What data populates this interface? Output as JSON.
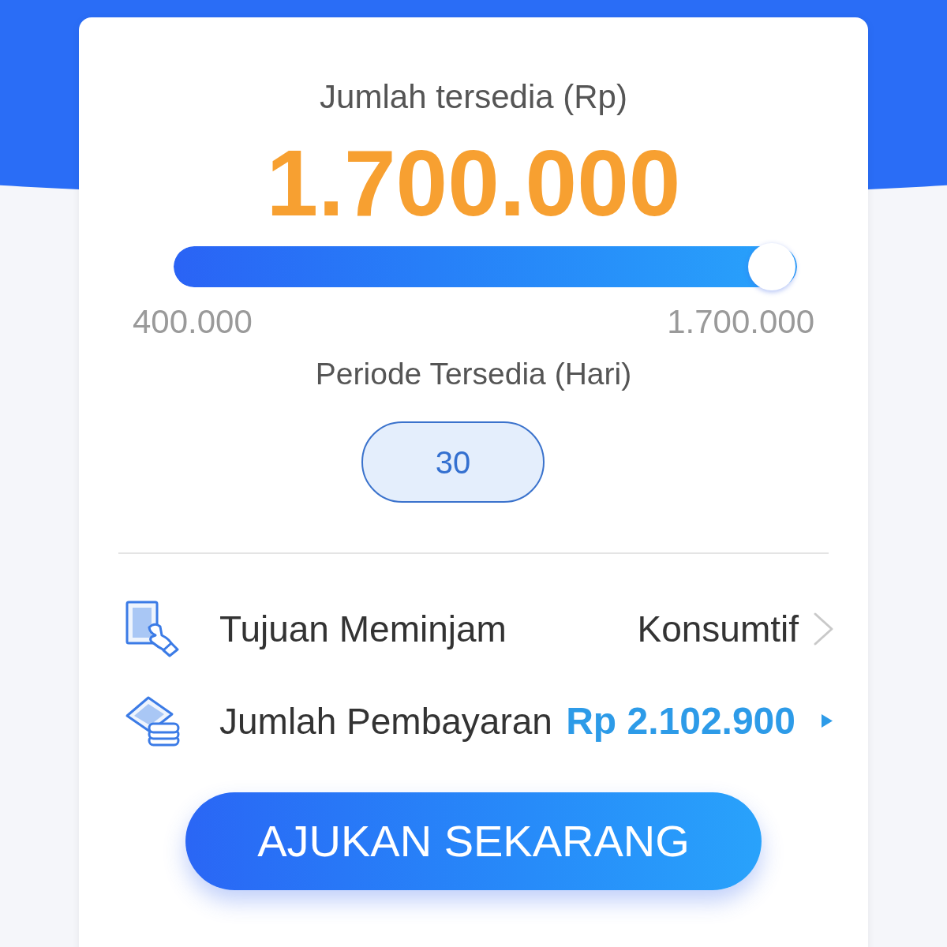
{
  "amount": {
    "label": "Jumlah tersedia (Rp)",
    "value": "1.700.000"
  },
  "slider": {
    "level": 1,
    "min_label": "400.000",
    "max_label": "1.700.000"
  },
  "period": {
    "label": "Periode Tersedia (Hari)",
    "options": [
      {
        "label": "30",
        "selected": true
      }
    ]
  },
  "details": [
    {
      "kind": "select",
      "label": "Tujuan Meminjam",
      "value": "Konsumtif"
    },
    {
      "kind": "amount",
      "label": "Jumlah Pembayaran",
      "value": "Rp 2.102.900"
    }
  ],
  "submit_button": "AJUKAN SEKARANG"
}
